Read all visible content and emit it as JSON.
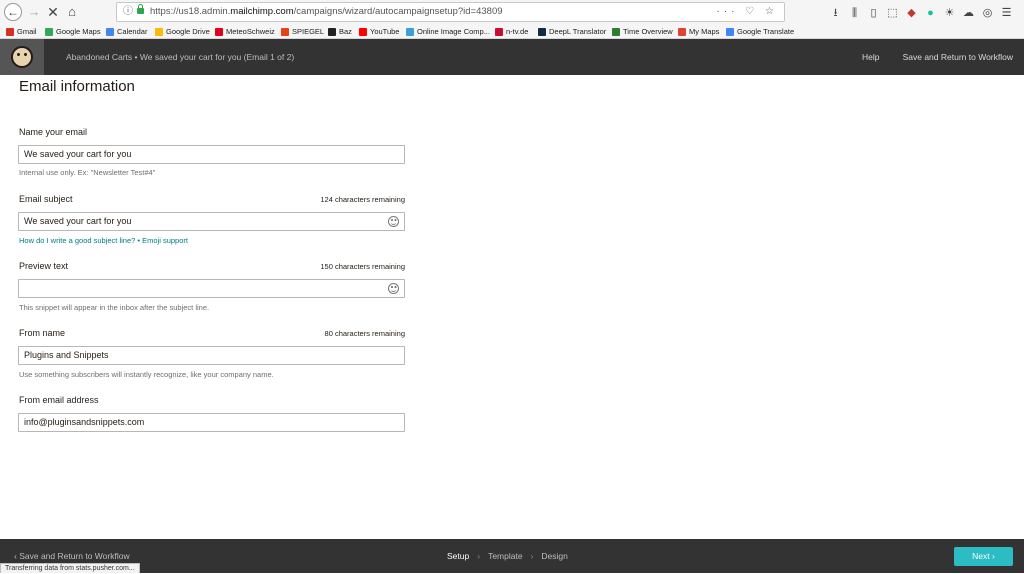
{
  "browser": {
    "url_prefix": "https://us18.admin.",
    "url_domain": "mailchimp.com",
    "url_path": "/campaigns/wizard/autocampaignsetup?id=43809",
    "url_actions": "··· ♡ ☆",
    "bookmarks": [
      {
        "label": "Gmail",
        "color": "#d93025"
      },
      {
        "label": "Google Maps",
        "color": "#34a853"
      },
      {
        "label": "Calendar",
        "color": "#4285f4"
      },
      {
        "label": "Google Drive",
        "color": "#fbbc04"
      },
      {
        "label": "MeteoSchweiz",
        "color": "#e2001a"
      },
      {
        "label": "SPIEGEL",
        "color": "#e64415"
      },
      {
        "label": "Baz",
        "color": "#222222"
      },
      {
        "label": "YouTube",
        "color": "#ff0000"
      },
      {
        "label": "Online Image Comp...",
        "color": "#3aa0d8"
      },
      {
        "label": "n-tv.de",
        "color": "#c8102e"
      },
      {
        "label": "DeepL Translator",
        "color": "#0f2b46"
      },
      {
        "label": "Time Overview",
        "color": "#2e7d32"
      },
      {
        "label": "My Maps",
        "color": "#db4437"
      },
      {
        "label": "Google Translate",
        "color": "#4285f4"
      }
    ],
    "status_text": "Transferring data from stats.pusher.com..."
  },
  "header": {
    "title": "Abandoned Carts • We saved your cart for you (Email 1 of 2)",
    "help_label": "Help",
    "save_label": "Save and Return to Workflow"
  },
  "form": {
    "section_title": "Email information",
    "name": {
      "label": "Name your email",
      "value": "We saved your cart for you",
      "help": "Internal use only. Ex: \"Newsletter Test#4\""
    },
    "subject": {
      "label": "Email subject",
      "counter": "124 characters remaining",
      "value": "We saved your cart for you",
      "help_link_1": "How do I write a good subject line?",
      "help_sep": " • ",
      "help_link_2": "Emoji support"
    },
    "preview": {
      "label": "Preview text",
      "counter": "150 characters remaining",
      "value": "",
      "help": "This snippet will appear in the inbox after the subject line."
    },
    "from_name": {
      "label": "From name",
      "counter": "80 characters remaining",
      "value": "Plugins and Snippets",
      "help": "Use something subscribers will instantly recognize, like your company name."
    },
    "from_email": {
      "label": "From email address",
      "value": "info@pluginsandsnippets.com"
    }
  },
  "footer": {
    "save_label": "Save and Return to Workflow",
    "steps": [
      "Setup",
      "Template",
      "Design"
    ],
    "next_label": "Next"
  },
  "colors": {
    "header_bg": "#333333",
    "accent_teal": "#2bbcc4",
    "link": "#007c89"
  }
}
